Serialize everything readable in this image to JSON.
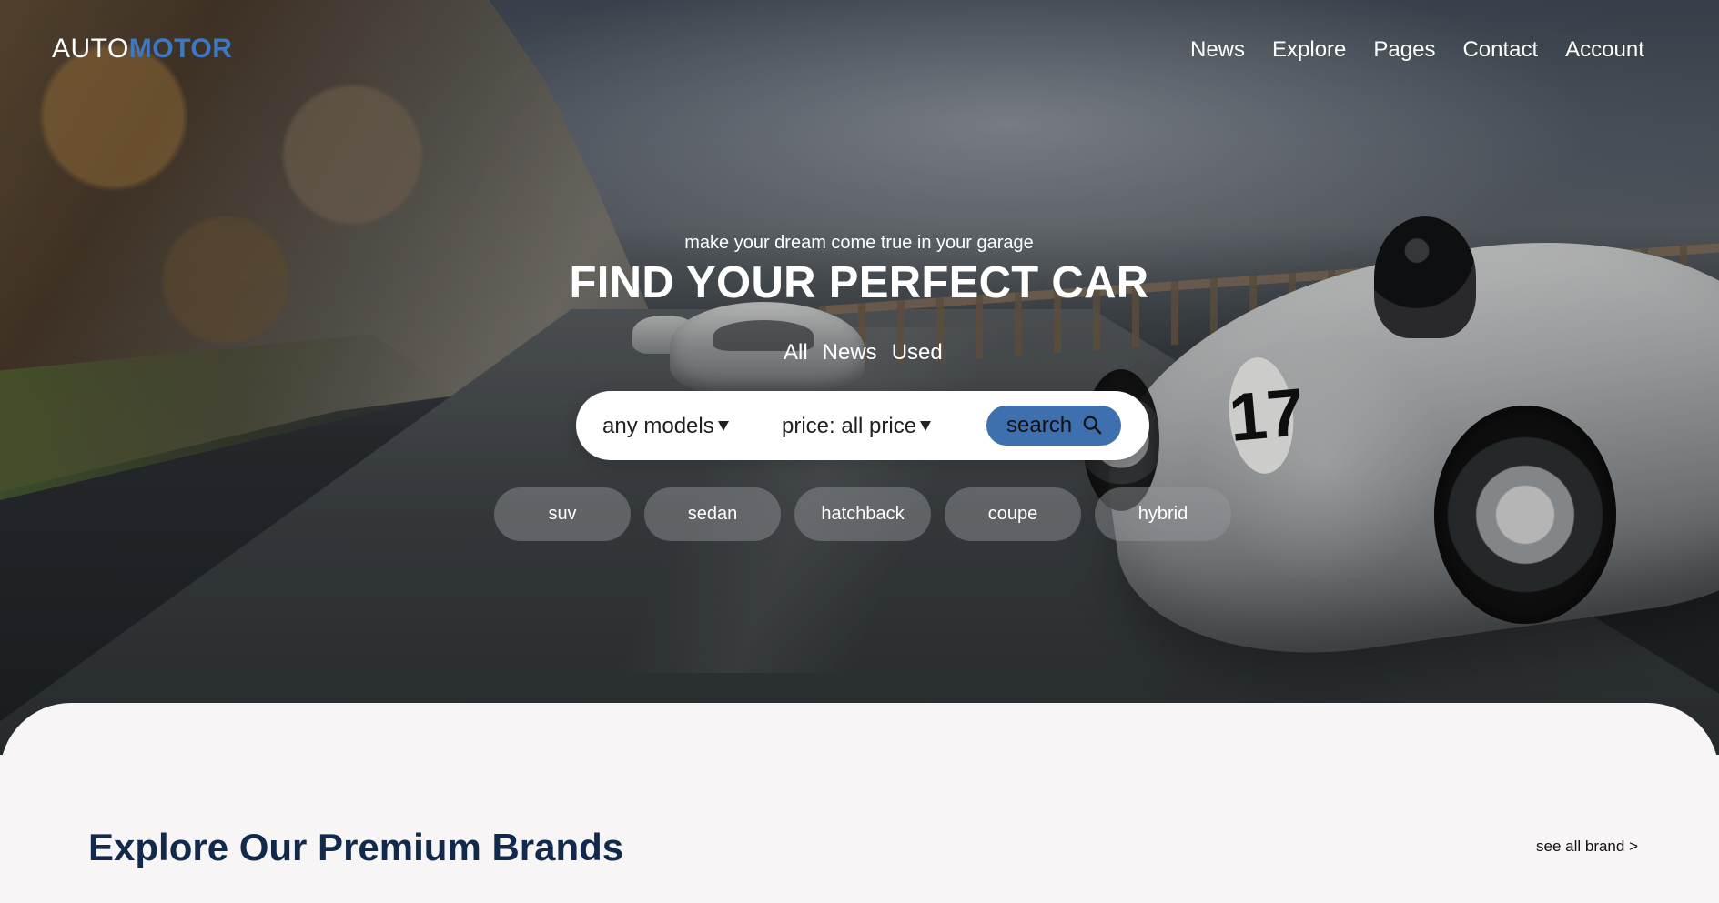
{
  "header": {
    "logo": {
      "part1": "AUTO",
      "part2": "MOTOR"
    },
    "nav_items": [
      "News",
      "Explore",
      "Pages",
      "Contact",
      "Account"
    ]
  },
  "hero": {
    "tagline": "make your dream come true in your garage",
    "title": "FIND YOUR PERFECT CAR",
    "filter_tabs": [
      "All",
      "News",
      "Used"
    ],
    "search": {
      "model_select": "any models",
      "price_select": "price: all price",
      "button_label": "search",
      "button_icon": "search-icon"
    },
    "categories": [
      "suv",
      "sedan",
      "hatchback",
      "coupe",
      "hybrid"
    ]
  },
  "brands": {
    "title": "Explore Our Premium Brands",
    "see_all": "see all brand >"
  },
  "colors": {
    "brand_accent": "#3e78c3",
    "search_button": "#3e6fae",
    "section_title": "#13294b",
    "page_background": "#f7f5f6"
  }
}
